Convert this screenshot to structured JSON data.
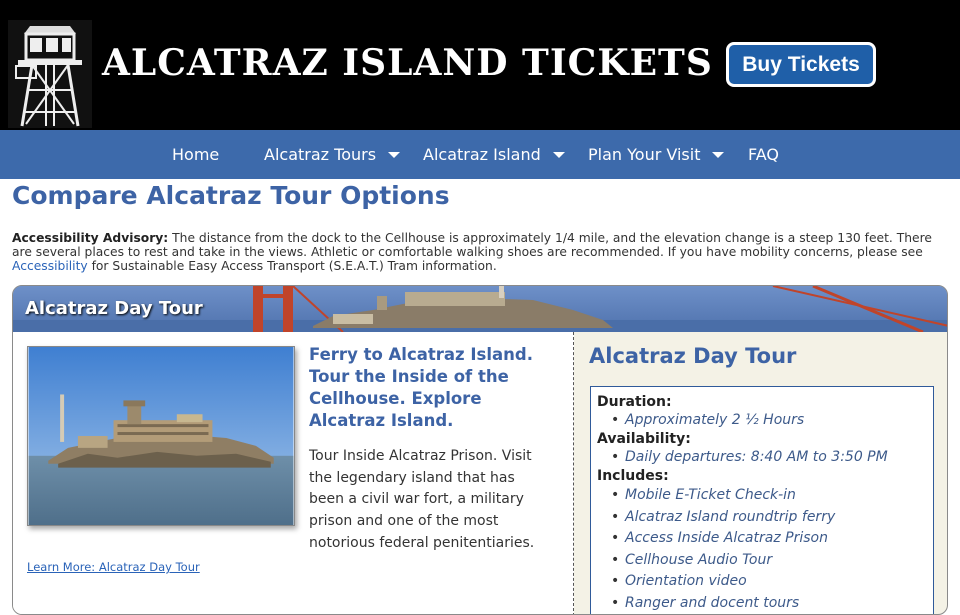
{
  "header": {
    "site_title": "ALCATRAZ ISLAND TICKETS",
    "buy_button": "Buy Tickets"
  },
  "nav": {
    "items": [
      {
        "label": "Home",
        "dropdown": false
      },
      {
        "label": "Alcatraz Tours",
        "dropdown": true
      },
      {
        "label": "Alcatraz Island",
        "dropdown": true
      },
      {
        "label": "Plan Your Visit",
        "dropdown": true
      },
      {
        "label": "FAQ",
        "dropdown": false
      }
    ]
  },
  "main": {
    "title": "Compare Alcatraz Tour Options",
    "advisory": {
      "label": "Accessibility Advisory:",
      "text_before": " The distance from the dock to the Cellhouse is approximately 1/4 mile, and the elevation change is a steep 130 feet. There are several places to rest and take in the views. Athletic or comfortable walking shoes are recommended. If you have mobility concerns, please see ",
      "link": "Accessibility",
      "text_after": " for Sustainable Easy Access Transport (S.E.A.T.) Tram information."
    }
  },
  "tour": {
    "banner_title": "Alcatraz Day Tour",
    "headline": "Ferry to Alcatraz Island. Tour the Inside of the Cellhouse. Explore Alcatraz Island.",
    "description": "Tour Inside Alcatraz Prison. Visit the legendary island that has been a civil war fort, a military prison and one of the most notorious federal penitentiaries.",
    "learn_more": "Learn More: Alcatraz Day Tour",
    "right_title": "Alcatraz Day Tour",
    "duration_label": "Duration:",
    "duration": "Approximately 2 ½ Hours",
    "availability_label": "Availability:",
    "availability": "Daily departures: 8:40 AM to 3:50 PM",
    "includes_label": "Includes:",
    "includes": [
      "Mobile E-Ticket Check-in",
      "Alcatraz Island roundtrip ferry",
      "Access Inside Alcatraz Prison",
      "Cellhouse Audio Tour",
      "Orientation video",
      "Ranger and docent tours"
    ]
  },
  "colors": {
    "header_bg": "#000000",
    "nav_bg": "#3d6aab",
    "title_blue": "#3d63a5",
    "buy_button_bg": "#1f5fa8",
    "link_blue": "#2a63b8"
  },
  "icons": {
    "logo": "guard-tower-icon",
    "nav_caret": "caret-down-icon"
  }
}
